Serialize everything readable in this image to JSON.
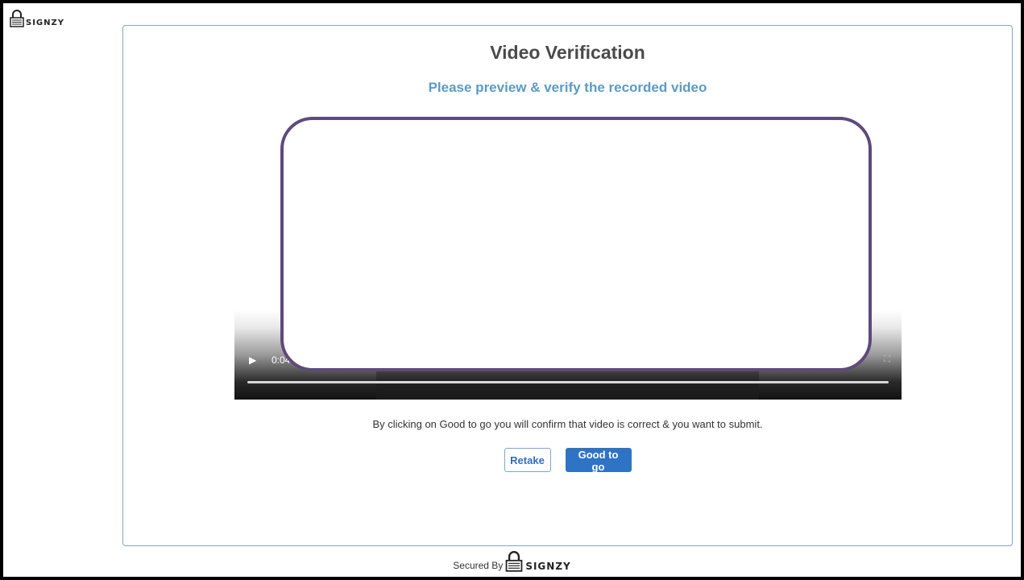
{
  "brand": {
    "logo_text": "SIGNZY"
  },
  "card": {
    "title": "Video Verification",
    "subtitle": "Please preview & verify the recorded video"
  },
  "video": {
    "play_glyph": "▶",
    "current_time": "0:04",
    "fullscreen_glyph": "⛶",
    "progress": 0
  },
  "confirm_text": "By clicking on Good to go you will confirm that video is correct & you want to submit.",
  "buttons": {
    "retake": "Retake",
    "good_to_go": "Good to go"
  },
  "footer": {
    "secured_by": "Secured By",
    "logo_text": "SIGNZY"
  },
  "colors": {
    "accent": "#2f73c4",
    "subtitle": "#5b9bc3",
    "overlay_border": "#5e4a7c",
    "card_border": "#7fa6cf"
  }
}
